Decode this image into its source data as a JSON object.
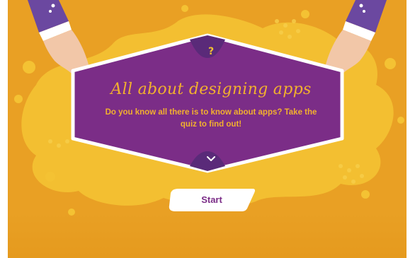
{
  "quiz": {
    "badge_symbol": "?",
    "title": "All about designing apps",
    "description": "Do you know all there is to know about apps? Take the quiz to find out!",
    "start_label": "Start"
  },
  "icons": {
    "badge_top": "question-mark-icon",
    "badge_bottom": "chevron-down-icon"
  },
  "colors": {
    "background": "#e9a024",
    "splash": "#f4c233",
    "card": "#7b2d87",
    "card_border": "#ffffff",
    "badge": "#5a2a79",
    "text_accent": "#f2b02e",
    "button": "#ffffff",
    "button_text": "#7b2d87",
    "sleeve": "#6b48a0",
    "skin": "#f2c7a8"
  }
}
